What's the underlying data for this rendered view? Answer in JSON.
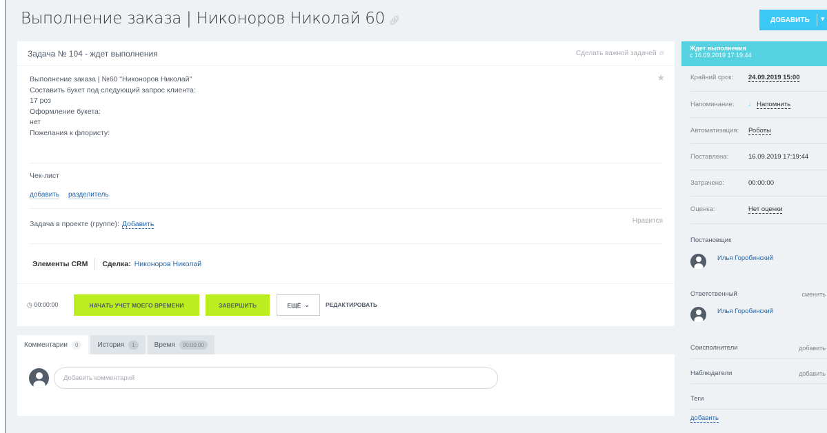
{
  "page": {
    "title": "Выполнение заказа | Никоноров Николай 60",
    "add_button": "ДОБАВИТЬ"
  },
  "task": {
    "header": "Задача № 104 - ждет выполнения",
    "make_important": "Сделать важной задачей",
    "description": [
      "Выполнение заказа | №60  \"Никоноров Николай\"",
      "Составить букет под следующий запрос клиента:",
      "17 роз",
      "Оформление букета:",
      "нет",
      "Пожелания к флористу:"
    ],
    "checklist_title": "Чек-лист",
    "checklist_add": "добавить",
    "checklist_separator": "разделитель",
    "project_label": "Задача в проекте (группе):",
    "project_add": "Добавить",
    "likes": "Нравится",
    "crm_label": "Элементы CRM",
    "deal_label": "Сделка:",
    "deal_value": "Никоноров Николай"
  },
  "actions": {
    "timer": "00:00:00",
    "start_time": "НАЧАТЬ УЧЕТ МОЕГО ВРЕМЕНИ",
    "complete": "ЗАВЕРШИТЬ",
    "more": "ЕЩЁ",
    "edit": "РЕДАКТИРОВАТЬ"
  },
  "tabs": [
    {
      "label": "Комментарии",
      "count": "0"
    },
    {
      "label": "История",
      "count": "1"
    },
    {
      "label": "Время",
      "count": "00:00:00"
    }
  ],
  "comment_placeholder": "Добавить комментарий",
  "sidebar": {
    "status_title": "Ждет выполнения",
    "status_since": "с 16.09.2019 17:19:44",
    "deadline_label": "Крайний срок:",
    "deadline_value": "24.09.2019 15:00",
    "reminder_label": "Напоминание:",
    "reminder_value": "Напомнить",
    "automation_label": "Автоматизация:",
    "automation_value": "Роботы",
    "created_label": "Поставлена:",
    "created_value": "16.09.2019 17:19:44",
    "spent_label": "Затрачено:",
    "spent_value": "00:00:00",
    "rating_label": "Оценка:",
    "rating_value": "Нет оценки",
    "creator_label": "Постановщик",
    "creator_name": "Илья Горобинский",
    "responsible_label": "Ответственный",
    "responsible_change": "сменить",
    "responsible_name": "Илья Горобинский",
    "coexec_label": "Соисполнители",
    "coexec_add": "добавить",
    "observers_label": "Наблюдатели",
    "observers_add": "добавить",
    "tags_label": "Теги",
    "tags_add": "добавить"
  },
  "colors": {
    "accent_blue": "#3bc8f5",
    "status_cyan": "#56d1e0",
    "green_button": "#bbed21",
    "link": "#2067b0"
  }
}
